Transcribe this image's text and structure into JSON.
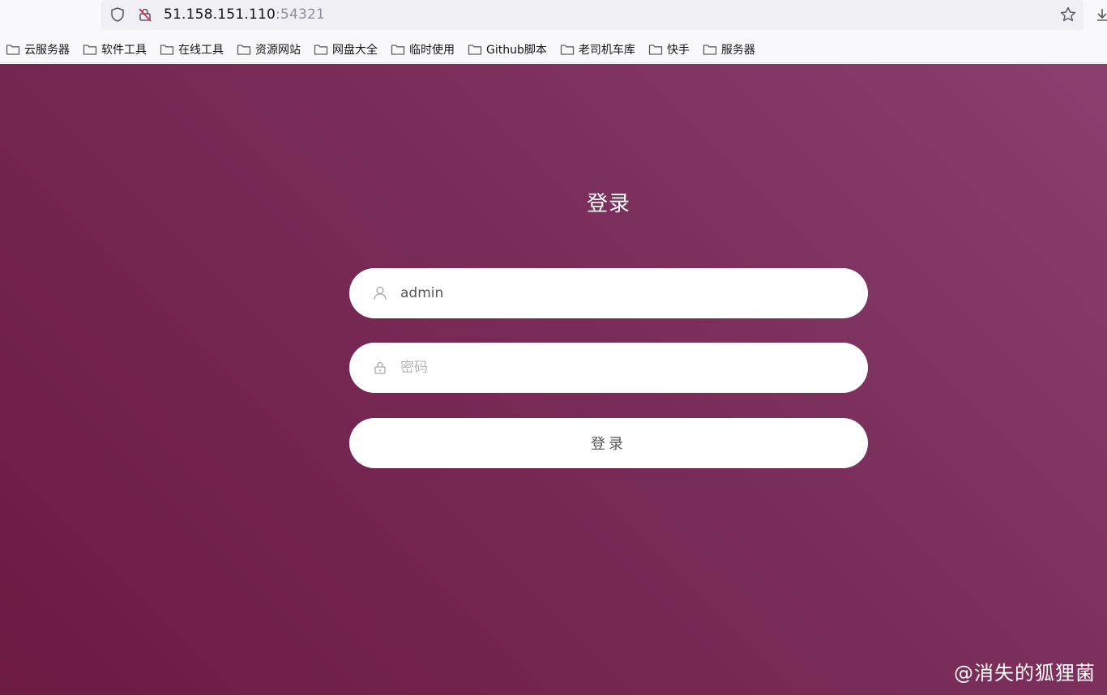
{
  "browser": {
    "url_host": "51.158.151.110",
    "url_port": ":54321",
    "bookmarks": [
      {
        "label": "云服务器"
      },
      {
        "label": "软件工具"
      },
      {
        "label": "在线工具"
      },
      {
        "label": "资源网站"
      },
      {
        "label": "网盘大全"
      },
      {
        "label": "临时使用"
      },
      {
        "label": "Github脚本"
      },
      {
        "label": "老司机车库"
      },
      {
        "label": "快手"
      },
      {
        "label": "服务器"
      }
    ]
  },
  "login": {
    "title": "登录",
    "username_value": "admin",
    "password_placeholder": "密码",
    "submit_label": "登录"
  },
  "watermark": "@消失的狐狸菌",
  "colors": {
    "background_start": "#8a3f70",
    "background_end": "#6b1a42",
    "field_bg": "#ffffff"
  }
}
